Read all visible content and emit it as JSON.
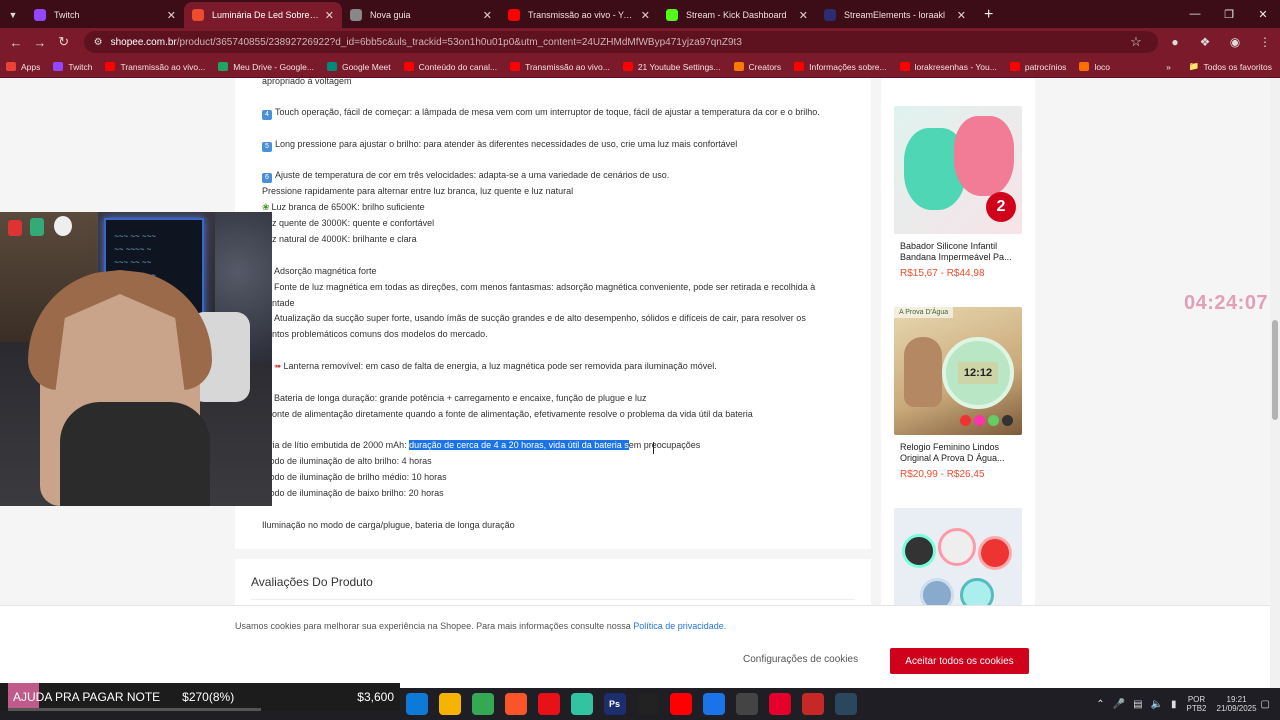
{
  "browser": {
    "tabs": [
      {
        "label": "Twitch",
        "icon": "twitch-icon",
        "color": "#9146ff",
        "active": false
      },
      {
        "label": "Luminária De Led Sobrepor Ba…",
        "icon": "shopee-icon",
        "color": "#ee4d2d",
        "active": true
      },
      {
        "label": "Nova guia",
        "icon": "chrome-icon",
        "color": "#888888",
        "active": false
      },
      {
        "label": "Transmissão ao vivo - YouTube",
        "icon": "youtube-icon",
        "color": "#ff0000",
        "active": false
      },
      {
        "label": "Stream - Kick Dashboard",
        "icon": "kick-icon",
        "color": "#53fc18",
        "active": false
      },
      {
        "label": "StreamElements - loraakl",
        "icon": "streamelements-icon",
        "color": "#2c2c70",
        "active": false
      }
    ],
    "url_host": "shopee.com.br",
    "url_path": "/product/365740855/23892726922?d_id=6bb5c&uls_trackid=53on1h0u01p0&utm_content=24UZHMdMfWByp471yjza97qnZ9t3",
    "bookmarks": [
      {
        "label": "Apps",
        "color": "#ea4335"
      },
      {
        "label": "Twitch",
        "color": "#9146ff"
      },
      {
        "label": "Transmissão ao vivo...",
        "color": "#ff0000"
      },
      {
        "label": "Meu Drive - Google...",
        "color": "#1fa463"
      },
      {
        "label": "Google Meet",
        "color": "#00897b"
      },
      {
        "label": "Conteúdo do canal...",
        "color": "#ff0000"
      },
      {
        "label": "Transmissão ao vivo...",
        "color": "#ff0000"
      },
      {
        "label": "21 Youtube Settings...",
        "color": "#ff0000"
      },
      {
        "label": "Creators",
        "color": "#f57c00"
      },
      {
        "label": "Informações sobre...",
        "color": "#ff0000"
      },
      {
        "label": "lorakresenhas - You...",
        "color": "#ff0000"
      },
      {
        "label": "patrocínios",
        "color": "#ff0000"
      },
      {
        "label": "loco",
        "color": "#ff6d00"
      }
    ],
    "all_favorites": "Todos os favoritos"
  },
  "description": {
    "top_fragment": "apropriado à voltagem",
    "lines": [
      {
        "n": "4",
        "text": "Touch operação, fácil de começar: a lâmpada de mesa vem com um interruptor de toque, fácil de ajustar a temperatura da cor e o brilho."
      },
      {
        "n": "5",
        "text": "Long pressione para ajustar o brilho: para atender às diferentes necessidades de uso, crie uma luz mais confortável"
      },
      {
        "n": "6",
        "text": "Ajuste de temperatura de cor em três velocidades: adapta-se a uma variedade de cenários de uso."
      },
      {
        "text": "Pressione rapidamente para alternar entre luz branca, luz quente e luz natural"
      },
      {
        "text": "Luz branca de 6500K: brilho suficiente"
      },
      {
        "text": "Luz quente de 3000K: quente e confortável"
      },
      {
        "text": "Luz natural de 4000K: brilhante e clara"
      },
      {
        "text": "Adsorção magnética forte"
      },
      {
        "text": "Fonte de luz magnética em todas as direções, com menos fantasmas: adsorção magnética conveniente, pode ser retirada e recolhida à"
      },
      {
        "text": "ntade"
      },
      {
        "text": "Atualização da sucção super forte, usando ímãs de sucção grandes e de alto desempenho, sólidos e difíceis de cair, para resolver os"
      },
      {
        "text": "ntos problemáticos comuns dos modelos do mercado."
      },
      {
        "text": "Lanterna removível: em caso de falta de energia, a luz magnética pode ser removida para iluminação móvel."
      },
      {
        "text": "Bateria de longa duração: grande potência + carregamento e encaixe, função de plugue e luz"
      },
      {
        "text": "onte de alimentação diretamente quando a fonte de alimentação, efetivamente resolve o problema da vida útil da bateria"
      }
    ],
    "battery_prefix": "teria de lítio embutida de 2000 mAh: ",
    "battery_selected": "duração de cerca de 4 a 20 horas, vida útil da bateria s",
    "battery_suffix": "em preocupações",
    "modes": [
      "Modo de iluminação de alto brilho: 4 horas",
      "Modo de iluminação de brilho médio: 10 horas",
      "Modo de iluminação de baixo brilho: 20 horas"
    ],
    "footer_line": "Iluminação no modo de carga/plugue, bateria de longa duração"
  },
  "reviews": {
    "title": "Avaliações Do Produto"
  },
  "recommendations": [
    {
      "name": "Babador Silicone Infantil Bandana Impermeável Pa...",
      "price": "R$15,67 - R$44,98",
      "icon": "bib-product-image",
      "badge": "2"
    },
    {
      "name": "Relogio Feminino Lindos Original A Prova D Água...",
      "price": "R$20,99 - R$26,45",
      "icon": "watch-product-image",
      "banner": "A Prova D'Água",
      "watch_time": "12:12"
    },
    {
      "name": "",
      "price": "",
      "icon": "watches-product-image"
    }
  ],
  "cookie": {
    "text": "Usamos cookies para melhorar sua experiência na Shopee. Para mais informações consulte nossa ",
    "link": "Política de privacidade.",
    "settings": "Configurações de cookies",
    "accept": "Aceitar todos os cookies"
  },
  "overlay": {
    "timer": "04:24:07",
    "goal_label": "AJUDA PRA PAGAR NOTE",
    "goal_amount": "$270(8%)",
    "goal_target": "$3,600",
    "goal_progress": 0.08
  },
  "taskbar": {
    "apps": [
      {
        "icon": "edge-icon",
        "color": "#0c7ad6"
      },
      {
        "icon": "chrome-icon",
        "color": "#f4b400"
      },
      {
        "icon": "chrome-active-icon",
        "color": "#34a853"
      },
      {
        "icon": "brave-icon",
        "color": "#fb542b"
      },
      {
        "icon": "opera-icon",
        "color": "#e8111a"
      },
      {
        "icon": "streamlabs-icon",
        "color": "#31c3a2"
      },
      {
        "icon": "photoshop-icon",
        "color": "#1c2e6e",
        "glyph": "Ps"
      },
      {
        "icon": "capcut-icon",
        "color": "#222222"
      },
      {
        "icon": "youtube-icon",
        "color": "#ff0000"
      },
      {
        "icon": "calendar-icon",
        "color": "#1a73e8"
      },
      {
        "icon": "notepad-icon",
        "color": "#444444"
      },
      {
        "icon": "obs-icon",
        "color": "#e4002b"
      },
      {
        "icon": "stream-tool-icon",
        "color": "#c62828"
      },
      {
        "icon": "steam-icon",
        "color": "#2a475e"
      }
    ],
    "lang": [
      "POR",
      "PTB2"
    ],
    "time": "19:21",
    "date": "21/09/2025"
  }
}
